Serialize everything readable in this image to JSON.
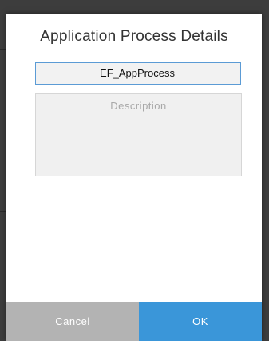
{
  "dialog": {
    "title": "Application Process Details",
    "name_value": "EF_AppProcess",
    "description_placeholder": "Description",
    "cancel_label": "Cancel",
    "ok_label": "OK"
  },
  "colors": {
    "ok_button": "#3a96d9",
    "cancel_button": "#b3b3b3",
    "input_border_focus": "#5b9bd5",
    "backdrop": "#3d3d3d"
  }
}
